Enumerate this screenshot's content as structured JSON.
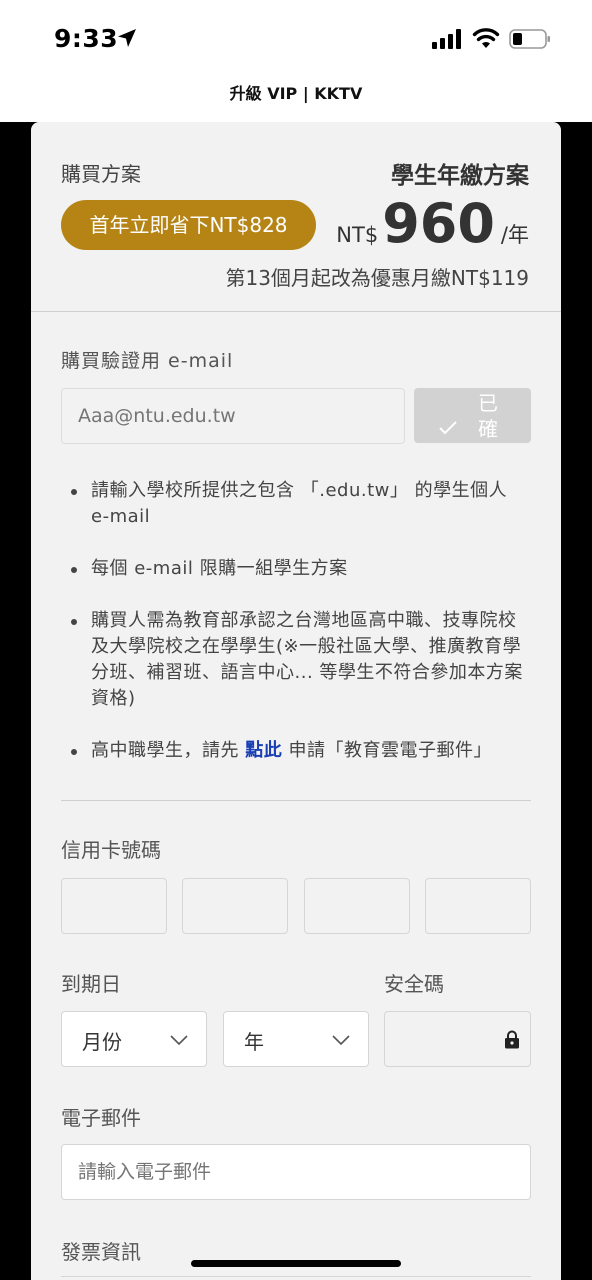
{
  "status_bar": {
    "time": "9:33",
    "icons": [
      "location-arrow-icon",
      "signal-icon",
      "wifi-icon",
      "battery-icon"
    ]
  },
  "page": {
    "title": "升級 VIP | KKTV"
  },
  "plan": {
    "label": "購買方案",
    "name": "學生年繳方案",
    "save_badge": "首年立即省下NT$828",
    "currency": "NT$",
    "amount": "960",
    "unit": "/年",
    "note": "第13個月起改為優惠月繳NT$119"
  },
  "verify_email": {
    "label": "購買驗證用 e-mail",
    "placeholder": "Aaa@ntu.edu.tw",
    "confirm_label": "已確"
  },
  "notes": {
    "item1": "請輸入學校所提供之包含 「.edu.tw」 的學生個人 e-mail",
    "item2": "每個 e-mail 限購一組學生方案",
    "item3": "購買人需為教育部承認之台灣地區高中職、技專院校及大學院校之在學學生(※一般社區大學、推廣教育學分班、補習班、語言中心... 等學生不符合參加本方案資格)",
    "item4_prefix": "高中職學生，請先 ",
    "item4_link": "點此",
    "item4_suffix": " 申請「教育雲電子郵件」"
  },
  "payment": {
    "card_label": "信用卡號碼",
    "expiry_label": "到期日",
    "month_value": "月份",
    "year_value": "年",
    "cvv_label": "安全碼"
  },
  "contact": {
    "email_label": "電子郵件",
    "email_placeholder": "請輸入電子郵件",
    "invoice_label": "發票資訊"
  },
  "colors": {
    "accent_gold": "#b58415",
    "link_blue": "#1a3fb5",
    "card_bg": "#f2f2f2"
  }
}
